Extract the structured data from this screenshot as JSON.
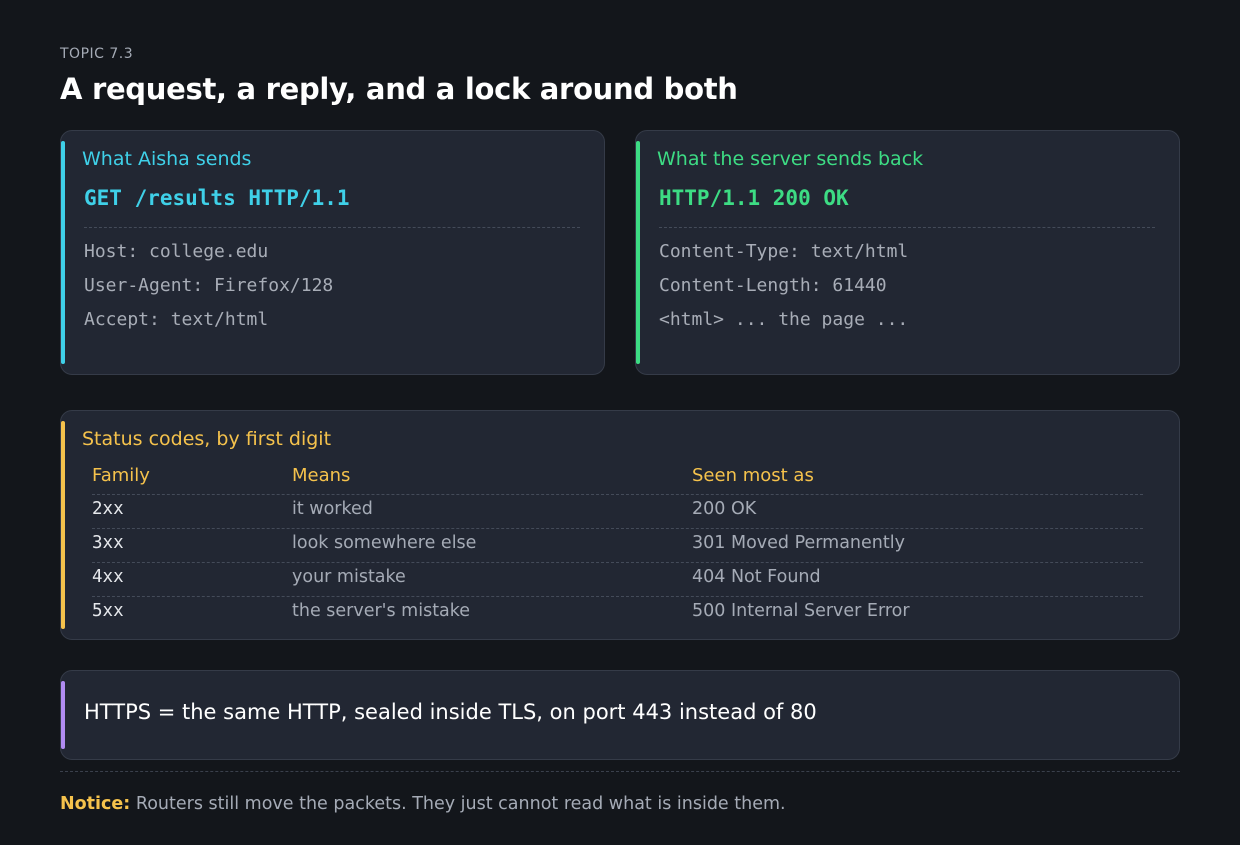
{
  "topic": "TOPIC 7.3",
  "title": "A request, a reply, and a lock around both",
  "colors": {
    "request_accent": "#3fd0e8",
    "response_accent": "#3ddc84",
    "status_accent": "#f5c24c",
    "https_accent": "#b18cf2"
  },
  "request": {
    "label": "What Aisha sends",
    "line": "GET /results HTTP/1.1",
    "headers": [
      "Host: college.edu",
      "User-Agent: Firefox/128",
      "Accept: text/html"
    ]
  },
  "response": {
    "label": "What the server sends back",
    "line": "HTTP/1.1 200 OK",
    "headers": [
      "Content-Type: text/html",
      "Content-Length: 61440",
      "<html> ... the page ..."
    ]
  },
  "status": {
    "label": "Status codes, by first digit",
    "columns": [
      "Family",
      "Means",
      "Seen most as"
    ],
    "rows": [
      [
        "2xx",
        "it worked",
        "200 OK"
      ],
      [
        "3xx",
        "look somewhere else",
        "301 Moved Permanently"
      ],
      [
        "4xx",
        "your mistake",
        "404 Not Found"
      ],
      [
        "5xx",
        "the server's mistake",
        "500 Internal Server Error"
      ]
    ]
  },
  "https_note": "HTTPS = the same HTTP, sealed inside TLS, on port 443 instead of 80",
  "notice": {
    "label": "Notice:",
    "text": " Routers still move the packets. They just cannot read what is inside them."
  }
}
